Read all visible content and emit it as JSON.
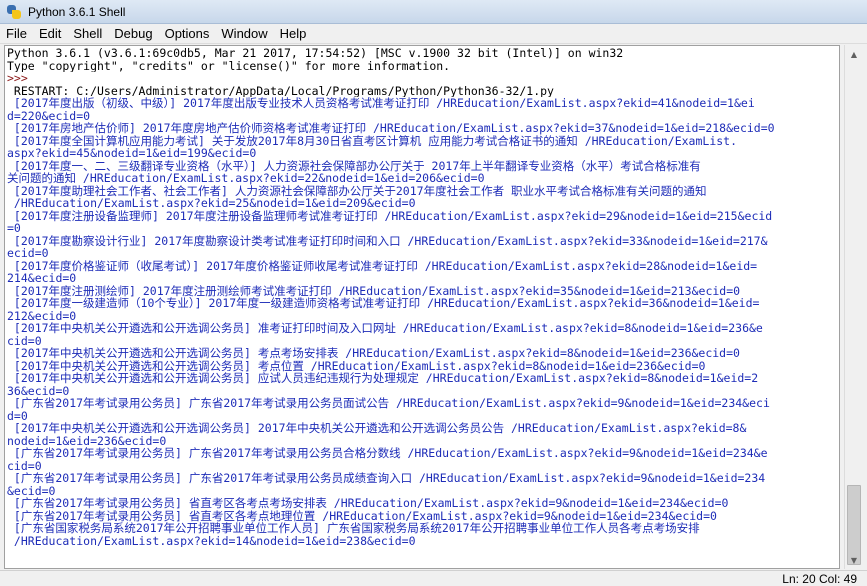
{
  "window": {
    "title": "Python 3.6.1 Shell"
  },
  "menu": [
    "File",
    "Edit",
    "Shell",
    "Debug",
    "Options",
    "Window",
    "Help"
  ],
  "shell": {
    "lines": [
      {
        "kind": "std",
        "text": "Python 3.6.1 (v3.6.1:69c0db5, Mar 21 2017, 17:54:52) [MSC v.1900 32 bit (Intel)] on win32"
      },
      {
        "kind": "std",
        "text": "Type \"copyright\", \"credits\" or \"license()\" for more information."
      },
      {
        "kind": "prompt",
        "text": ">>> "
      },
      {
        "kind": "std",
        "text": " RESTART: C:/Users/Administrator/AppData/Local/Programs/Python/Python36-32/1.py"
      },
      {
        "kind": "out",
        "text": " [2017年度出版（初级、中级）] 2017年度出版专业技术人员资格考试准考证打印 /HREducation/ExamList.aspx?ekid=41&nodeid=1&ei"
      },
      {
        "kind": "out",
        "text": "d=220&ecid=0"
      },
      {
        "kind": "out",
        "text": " [2017年房地产估价师] 2017年度房地产估价师资格考试准考证打印 /HREducation/ExamList.aspx?ekid=37&nodeid=1&eid=218&ecid=0"
      },
      {
        "kind": "out",
        "text": " [2017年度全国计算机应用能力考试] 关于发放2017年8月30日省直考区计算机 应用能力考试合格证书的通知 /HREducation/ExamList."
      },
      {
        "kind": "out",
        "text": "aspx?ekid=45&nodeid=1&eid=199&ecid=0"
      },
      {
        "kind": "out",
        "text": " [2017年度一、二、三级翻译专业资格（水平）] 人力资源社会保障部办公厅关于 2017年上半年翻译专业资格（水平）考试合格标准有"
      },
      {
        "kind": "out",
        "text": "关问题的通知 /HREducation/ExamList.aspx?ekid=22&nodeid=1&eid=206&ecid=0"
      },
      {
        "kind": "out",
        "text": " [2017年度助理社会工作者、社会工作者] 人力资源社会保障部办公厅关于2017年度社会工作者 职业水平考试合格标准有关问题的通知"
      },
      {
        "kind": "out",
        "text": " /HREducation/ExamList.aspx?ekid=25&nodeid=1&eid=209&ecid=0"
      },
      {
        "kind": "out",
        "text": " [2017年度注册设备监理师] 2017年度注册设备监理师考试准考证打印 /HREducation/ExamList.aspx?ekid=29&nodeid=1&eid=215&ecid"
      },
      {
        "kind": "out",
        "text": "=0"
      },
      {
        "kind": "out",
        "text": " [2017年度勘察设计行业] 2017年度勘察设计类考试准考证打印时间和入口 /HREducation/ExamList.aspx?ekid=33&nodeid=1&eid=217&"
      },
      {
        "kind": "out",
        "text": "ecid=0"
      },
      {
        "kind": "out",
        "text": " [2017年度价格鉴证师（收尾考试）] 2017年度价格鉴证师收尾考试准考证打印 /HREducation/ExamList.aspx?ekid=28&nodeid=1&eid="
      },
      {
        "kind": "out",
        "text": "214&ecid=0"
      },
      {
        "kind": "out",
        "text": " [2017年度注册测绘师] 2017年度注册测绘师考试准考证打印 /HREducation/ExamList.aspx?ekid=35&nodeid=1&eid=213&ecid=0"
      },
      {
        "kind": "out",
        "text": " [2017年度一级建造师（10个专业）] 2017年度一级建造师资格考试准考证打印 /HREducation/ExamList.aspx?ekid=36&nodeid=1&eid="
      },
      {
        "kind": "out",
        "text": "212&ecid=0"
      },
      {
        "kind": "out",
        "text": " [2017年中央机关公开遴选和公开选调公务员] 准考证打印时间及入口网址 /HREducation/ExamList.aspx?ekid=8&nodeid=1&eid=236&e"
      },
      {
        "kind": "out",
        "text": "cid=0"
      },
      {
        "kind": "out",
        "text": " [2017年中央机关公开遴选和公开选调公务员] 考点考场安排表 /HREducation/ExamList.aspx?ekid=8&nodeid=1&eid=236&ecid=0"
      },
      {
        "kind": "out",
        "text": " [2017年中央机关公开遴选和公开选调公务员] 考点位置 /HREducation/ExamList.aspx?ekid=8&nodeid=1&eid=236&ecid=0"
      },
      {
        "kind": "out",
        "text": " [2017年中央机关公开遴选和公开选调公务员] 应试人员违纪违规行为处理规定 /HREducation/ExamList.aspx?ekid=8&nodeid=1&eid=2"
      },
      {
        "kind": "out",
        "text": "36&ecid=0"
      },
      {
        "kind": "out",
        "text": " [广东省2017年考试录用公务员] 广东省2017年考试录用公务员面试公告 /HREducation/ExamList.aspx?ekid=9&nodeid=1&eid=234&eci"
      },
      {
        "kind": "out",
        "text": "d=0"
      },
      {
        "kind": "out",
        "text": " [2017年中央机关公开遴选和公开选调公务员] 2017年中央机关公开遴选和公开选调公务员公告 /HREducation/ExamList.aspx?ekid=8&"
      },
      {
        "kind": "out",
        "text": "nodeid=1&eid=236&ecid=0"
      },
      {
        "kind": "out",
        "text": " [广东省2017年考试录用公务员] 广东省2017年考试录用公务员合格分数线 /HREducation/ExamList.aspx?ekid=9&nodeid=1&eid=234&e"
      },
      {
        "kind": "out",
        "text": "cid=0"
      },
      {
        "kind": "out",
        "text": " [广东省2017年考试录用公务员] 广东省2017年考试录用公务员成绩查询入口 /HREducation/ExamList.aspx?ekid=9&nodeid=1&eid=234"
      },
      {
        "kind": "out",
        "text": "&ecid=0"
      },
      {
        "kind": "out",
        "text": " [广东省2017年考试录用公务员] 省直考区各考点考场安排表 /HREducation/ExamList.aspx?ekid=9&nodeid=1&eid=234&ecid=0"
      },
      {
        "kind": "out",
        "text": " [广东省2017年考试录用公务员] 省直考区各考点地理位置 /HREducation/ExamList.aspx?ekid=9&nodeid=1&eid=234&ecid=0"
      },
      {
        "kind": "out",
        "text": " [广东省国家税务局系统2017年公开招聘事业单位工作人员] 广东省国家税务局系统2017年公开招聘事业单位工作人员各考点考场安排"
      },
      {
        "kind": "out",
        "text": " /HREducation/ExamList.aspx?ekid=14&nodeid=1&eid=238&ecid=0"
      }
    ]
  },
  "status": {
    "text": "Ln: 20  Col: 49"
  },
  "icons": {
    "app": "python-logo-icon",
    "scroll_up": "arrow-up-icon",
    "scroll_down": "arrow-down-icon"
  }
}
